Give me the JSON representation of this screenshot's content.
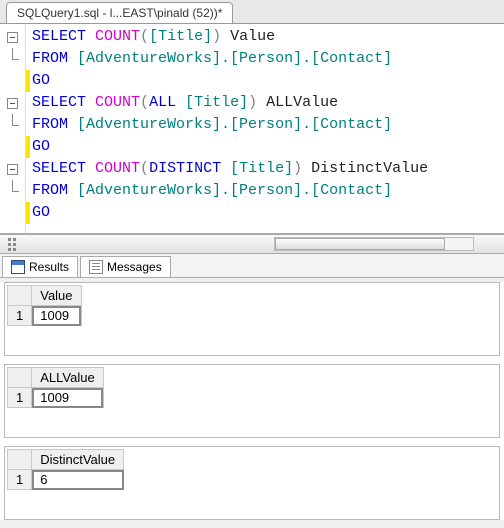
{
  "tab": {
    "title": "SQLQuery1.sql - l...EAST\\pinald (52))*"
  },
  "sql": {
    "lines": [
      {
        "kind": "select",
        "count_arg": "[Title]",
        "alias": "Value",
        "prefix": ""
      },
      {
        "kind": "from",
        "text": "[AdventureWorks].[Person].[Contact]"
      },
      {
        "kind": "go"
      },
      {
        "kind": "select",
        "count_arg": "[Title]",
        "alias": "ALLValue",
        "prefix": "ALL "
      },
      {
        "kind": "from",
        "text": "[AdventureWorks].[Person].[Contact]"
      },
      {
        "kind": "go"
      },
      {
        "kind": "select",
        "count_arg": "[Title]",
        "alias": "DistinctValue",
        "prefix": "DISTINCT "
      },
      {
        "kind": "from",
        "text": "[AdventureWorks].[Person].[Contact]"
      },
      {
        "kind": "go"
      }
    ],
    "kw": {
      "select": "SELECT",
      "from": "FROM",
      "count": "COUNT",
      "go": "GO"
    }
  },
  "results_tabs": {
    "results": "Results",
    "messages": "Messages"
  },
  "results": [
    {
      "col": "Value",
      "row": "1",
      "val": "1009"
    },
    {
      "col": "ALLValue",
      "row": "1",
      "val": "1009"
    },
    {
      "col": "DistinctValue",
      "row": "1",
      "val": "6"
    }
  ]
}
